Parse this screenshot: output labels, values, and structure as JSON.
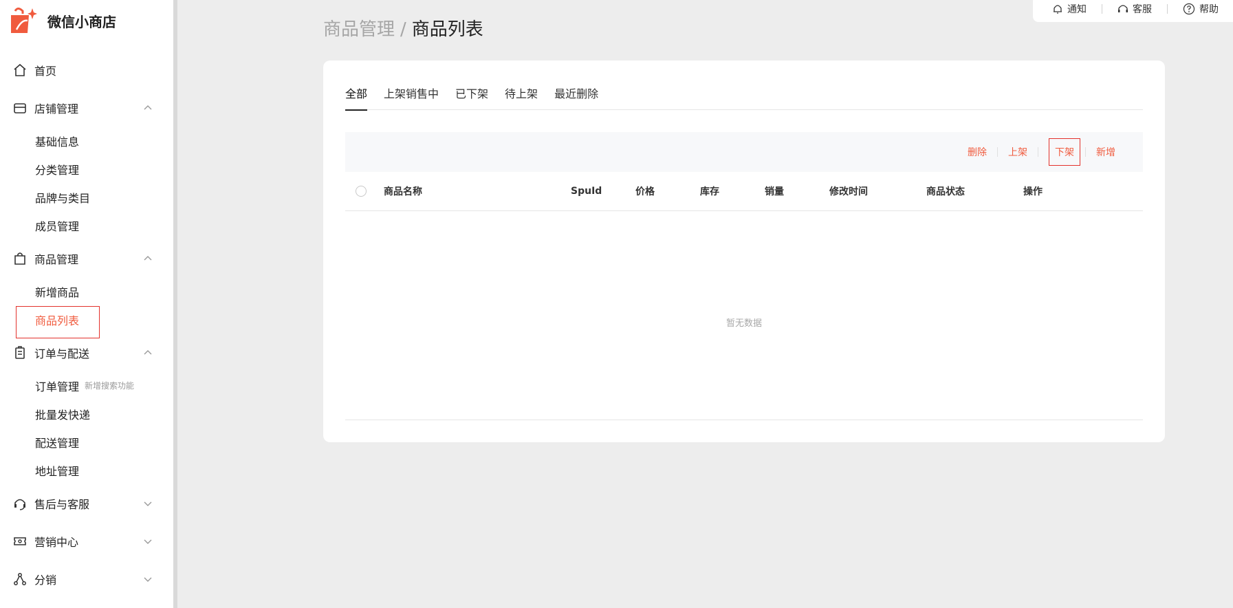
{
  "app": {
    "name": "微信小商店"
  },
  "colors": {
    "accent": "#f05b3e",
    "active_border": "#e3312b",
    "background": "#ededed"
  },
  "topbar": {
    "items": [
      {
        "label": "通知",
        "icon": "bell-icon"
      },
      {
        "label": "客服",
        "icon": "headset-icon"
      },
      {
        "label": "帮助",
        "icon": "help-icon"
      }
    ]
  },
  "sidebar": {
    "home": {
      "label": "首页",
      "icon": "home-icon"
    },
    "store": {
      "label": "店铺管理",
      "icon": "store-icon",
      "expanded": true,
      "items": [
        "基础信息",
        "分类管理",
        "品牌与类目",
        "成员管理"
      ]
    },
    "goods": {
      "label": "商品管理",
      "icon": "bag-icon",
      "expanded": true,
      "items": [
        "新增商品",
        "商品列表"
      ],
      "active_item": "商品列表"
    },
    "orders": {
      "label": "订单与配送",
      "icon": "clipboard-icon",
      "expanded": true,
      "items": [
        "订单管理",
        "批量发快递",
        "配送管理",
        "地址管理"
      ],
      "badge": "新增搜索功能"
    },
    "aftersale": {
      "label": "售后与客服",
      "icon": "headset-icon",
      "expanded": false
    },
    "marketing": {
      "label": "营销中心",
      "icon": "ticket-icon",
      "expanded": false
    },
    "distribution": {
      "label": "分销",
      "icon": "share-icon",
      "expanded": false
    }
  },
  "breadcrumb": {
    "parent": "商品管理",
    "separator": "/",
    "current": "商品列表"
  },
  "tabs": [
    "全部",
    "上架销售中",
    "已下架",
    "待上架",
    "最近删除"
  ],
  "active_tab": "全部",
  "actions": [
    "删除",
    "上架",
    "下架",
    "新增"
  ],
  "table": {
    "columns": [
      "商品名称",
      "SpuId",
      "价格",
      "库存",
      "销量",
      "修改时间",
      "商品状态",
      "操作"
    ],
    "rows": [],
    "empty_text": "暂无数据"
  }
}
